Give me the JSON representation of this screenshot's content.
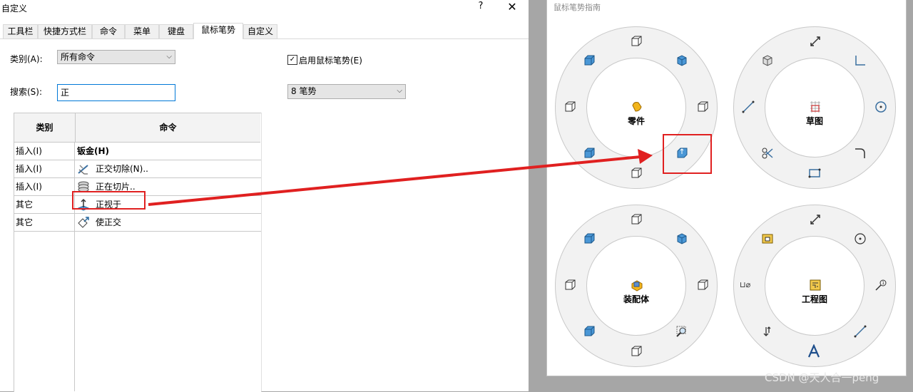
{
  "window": {
    "title": "自定义",
    "help": "?",
    "close": "✕"
  },
  "tabs": [
    {
      "label": "工具栏"
    },
    {
      "label": "快捷方式栏"
    },
    {
      "label": "命令"
    },
    {
      "label": "菜单"
    },
    {
      "label": "键盘"
    },
    {
      "label": "鼠标笔势"
    },
    {
      "label": "自定义"
    }
  ],
  "active_tab": "鼠标笔势",
  "form": {
    "category_label": "类别(A):",
    "category_value": "所有命令",
    "search_label": "搜索(S):",
    "search_value": "正",
    "enable_label": "启用鼠标笔势(E)",
    "enable_checked": "✓",
    "gesture_count_value": "8 笔势"
  },
  "table": {
    "headers": [
      "类别",
      "命令"
    ],
    "rows": [
      {
        "category": "插入(I)",
        "command": "钣金(H)",
        "bold": true,
        "icon": "none"
      },
      {
        "category": "插入(I)",
        "command": "正交切除(N)..",
        "icon": "cut-icon"
      },
      {
        "category": "插入(I)",
        "command": "正在切片..",
        "icon": "slice-icon"
      },
      {
        "category": "其它",
        "command": "正视于",
        "icon": "normal-to-icon"
      },
      {
        "category": "其它",
        "command": "使正交",
        "icon": "make-orthogonal-icon"
      }
    ]
  },
  "guide": {
    "title": "鼠标笔势指南",
    "rings": [
      {
        "label": "零件"
      },
      {
        "label": "草图"
      },
      {
        "label": "装配体"
      },
      {
        "label": "工程图"
      }
    ],
    "drawing_ring_glyph_text": "⊔⌀"
  },
  "watermark": "CSDN @天人合一peng",
  "colors": {
    "highlight": "#e02020",
    "selection_border": "#0078d7",
    "icon_blue": "#3a8fd0"
  }
}
